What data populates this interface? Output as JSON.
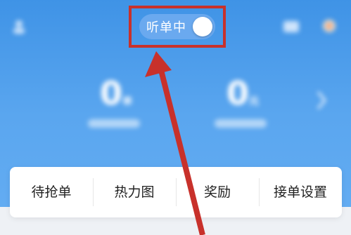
{
  "header": {
    "listen_toggle": {
      "label": "听单中",
      "state": "on"
    },
    "left_icon": "user-icon",
    "right_icons": [
      "message-icon",
      "settings-icon"
    ],
    "background_color": "#4a9be8"
  },
  "stats": [
    {
      "value": "0",
      "unit": "单"
    },
    {
      "value": "0",
      "unit": "元"
    }
  ],
  "menu": {
    "items": [
      {
        "label": "待抢单"
      },
      {
        "label": "热力图"
      },
      {
        "label": "奖励"
      },
      {
        "label": "接单设置"
      }
    ]
  },
  "annotation": {
    "color": "#c8312b",
    "type": "arrow-and-box"
  }
}
